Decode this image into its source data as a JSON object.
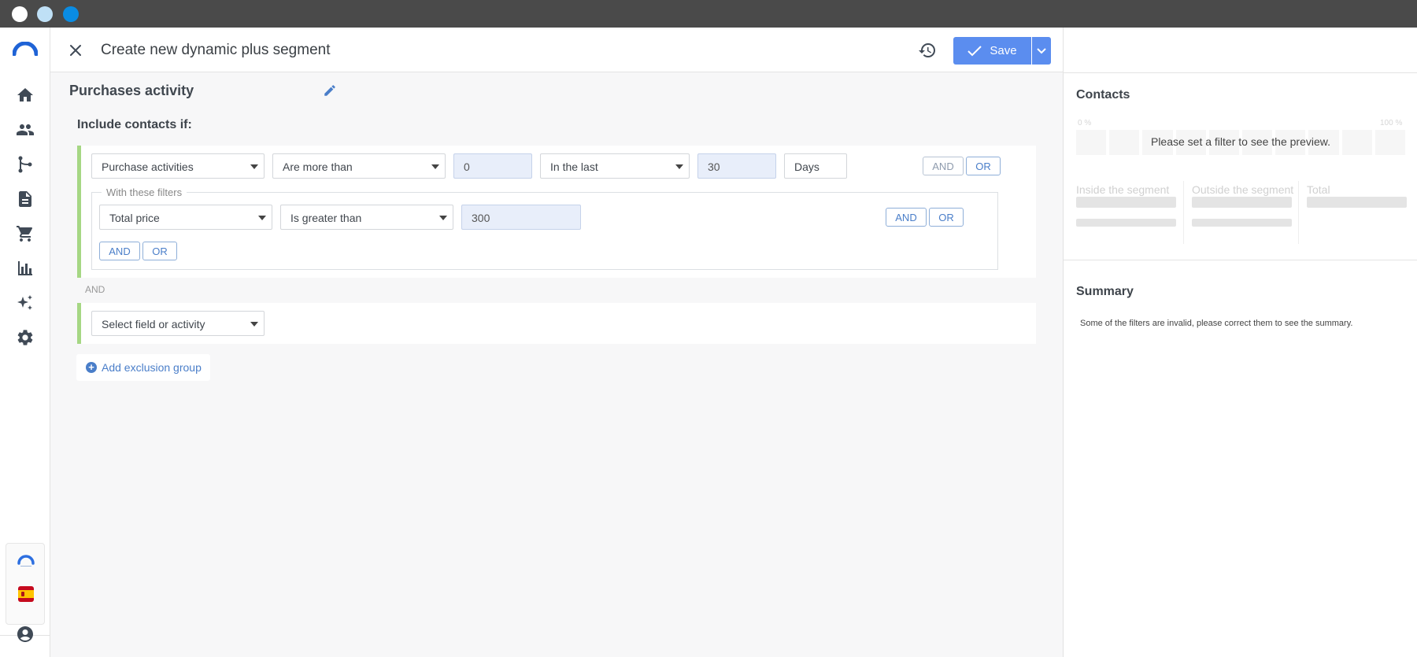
{
  "window": {
    "buttons": [
      {
        "name": "window-close",
        "color": "#ffffff"
      },
      {
        "name": "window-minimize",
        "color": "#bfe0f6"
      },
      {
        "name": "window-maximize",
        "color": "#0a8ce3"
      }
    ]
  },
  "sidebar": {
    "items": [
      {
        "name": "home",
        "icon": "home-icon"
      },
      {
        "name": "contacts",
        "icon": "people-icon"
      },
      {
        "name": "automation",
        "icon": "flow-icon"
      },
      {
        "name": "content",
        "icon": "document-icon"
      },
      {
        "name": "ecommerce",
        "icon": "cart-icon"
      },
      {
        "name": "reports",
        "icon": "chart-icon"
      },
      {
        "name": "ai",
        "icon": "sparkles-icon"
      },
      {
        "name": "settings",
        "icon": "gear-icon"
      }
    ],
    "bottom": [
      "brand-mini-logo",
      "spain-flag-icon",
      "account-icon"
    ]
  },
  "header": {
    "title": "Create new dynamic plus segment",
    "save_label": "Save"
  },
  "editor": {
    "section_title": "Purchases activity",
    "include_label": "Include contacts if:",
    "group1": {
      "activity": "Purchase activities",
      "operator": "Are more than",
      "count": "0",
      "timeframe": "In the last",
      "amount": "30",
      "unit": "Days",
      "and_label": "AND",
      "or_label": "OR",
      "filters_legend": "With these filters",
      "filter": {
        "field": "Total price",
        "operator": "Is greater than",
        "value": "300",
        "and_label": "AND",
        "or_label": "OR"
      },
      "filters_and_label": "AND",
      "filters_or_label": "OR"
    },
    "separator": "AND",
    "group2": {
      "placeholder": "Select field or activity"
    },
    "add_exclusion_label": "Add exclusion group"
  },
  "right_panel": {
    "contacts_title": "Contacts",
    "pct_min": "0 %",
    "pct_max": "100 %",
    "preview_message": "Please set a filter to see the preview.",
    "inside_label": "Inside the segment",
    "outside_label": "Outside the segment",
    "total_label": "Total",
    "summary_title": "Summary",
    "summary_message": "Some of the filters are invalid, please correct them to see the summary."
  },
  "colors": {
    "accent": "#5b8def",
    "group_border": "#a6d784",
    "titlebar": "#4a4a4a"
  }
}
